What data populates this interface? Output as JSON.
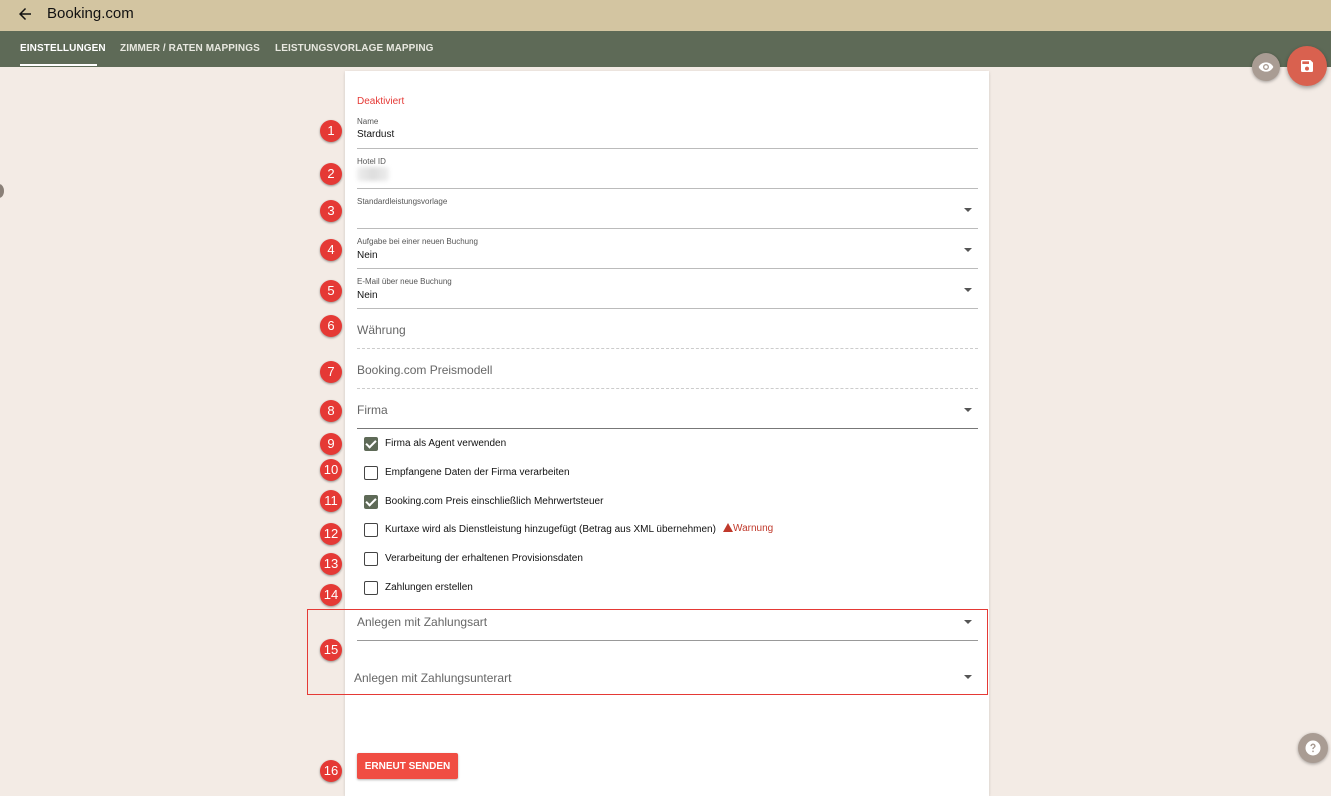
{
  "header": {
    "title": "Booking.com"
  },
  "tabs": [
    {
      "label": "EINSTELLUNGEN"
    },
    {
      "label": "ZIMMER / RATEN MAPPINGS"
    },
    {
      "label": "LEISTUNGSVORLAGE MAPPING"
    }
  ],
  "form": {
    "status": "Deaktiviert",
    "name_label": "Name",
    "name_value": "Stardust",
    "hotel_id_label": "Hotel ID",
    "standard_template_label": "Standardleistungsvorlage",
    "task_label": "Aufgabe bei einer neuen Buchung",
    "task_value": "Nein",
    "email_label": "E-Mail über neue Buchung",
    "email_value": "Nein",
    "currency_placeholder": "Währung",
    "pricing_placeholder": "Booking.com Preismodell",
    "company_placeholder": "Firma",
    "checkboxes": [
      {
        "label": "Firma als Agent verwenden",
        "checked": true
      },
      {
        "label": "Empfangene Daten der Firma verarbeiten",
        "checked": false
      },
      {
        "label": "Booking.com Preis einschließlich Mehrwertsteuer",
        "checked": true
      },
      {
        "label": "Kurtaxe wird als Dienstleistung hinzugefügt (Betrag aus XML übernehmen)",
        "checked": false
      },
      {
        "label": "Verarbeitung der erhaltenen Provisionsdaten",
        "checked": false
      },
      {
        "label": "Zahlungen erstellen",
        "checked": false
      }
    ],
    "warning_text": "Warnung",
    "payment_type_placeholder": "Anlegen mit Zahlungsart",
    "payment_subtype_placeholder": "Anlegen mit Zahlungsunterart",
    "resend_label": "ERNEUT SENDEN"
  },
  "annotations": [
    "1",
    "2",
    "3",
    "4",
    "5",
    "6",
    "7",
    "8",
    "9",
    "10",
    "11",
    "12",
    "13",
    "14",
    "15",
    "16"
  ],
  "colors": {
    "topbar": "#d3c5a1",
    "tabbar": "#5e6a57",
    "page_bg": "#f3ebe5",
    "accent_red": "#e53935",
    "save_fab": "#d9614f"
  },
  "icons": {
    "back": "arrow-left-icon",
    "preview": "eye-icon",
    "save": "floppy-disk-icon",
    "help": "question-mark-icon",
    "dropdown": "caret-down-icon",
    "warning": "warning-triangle-icon"
  }
}
